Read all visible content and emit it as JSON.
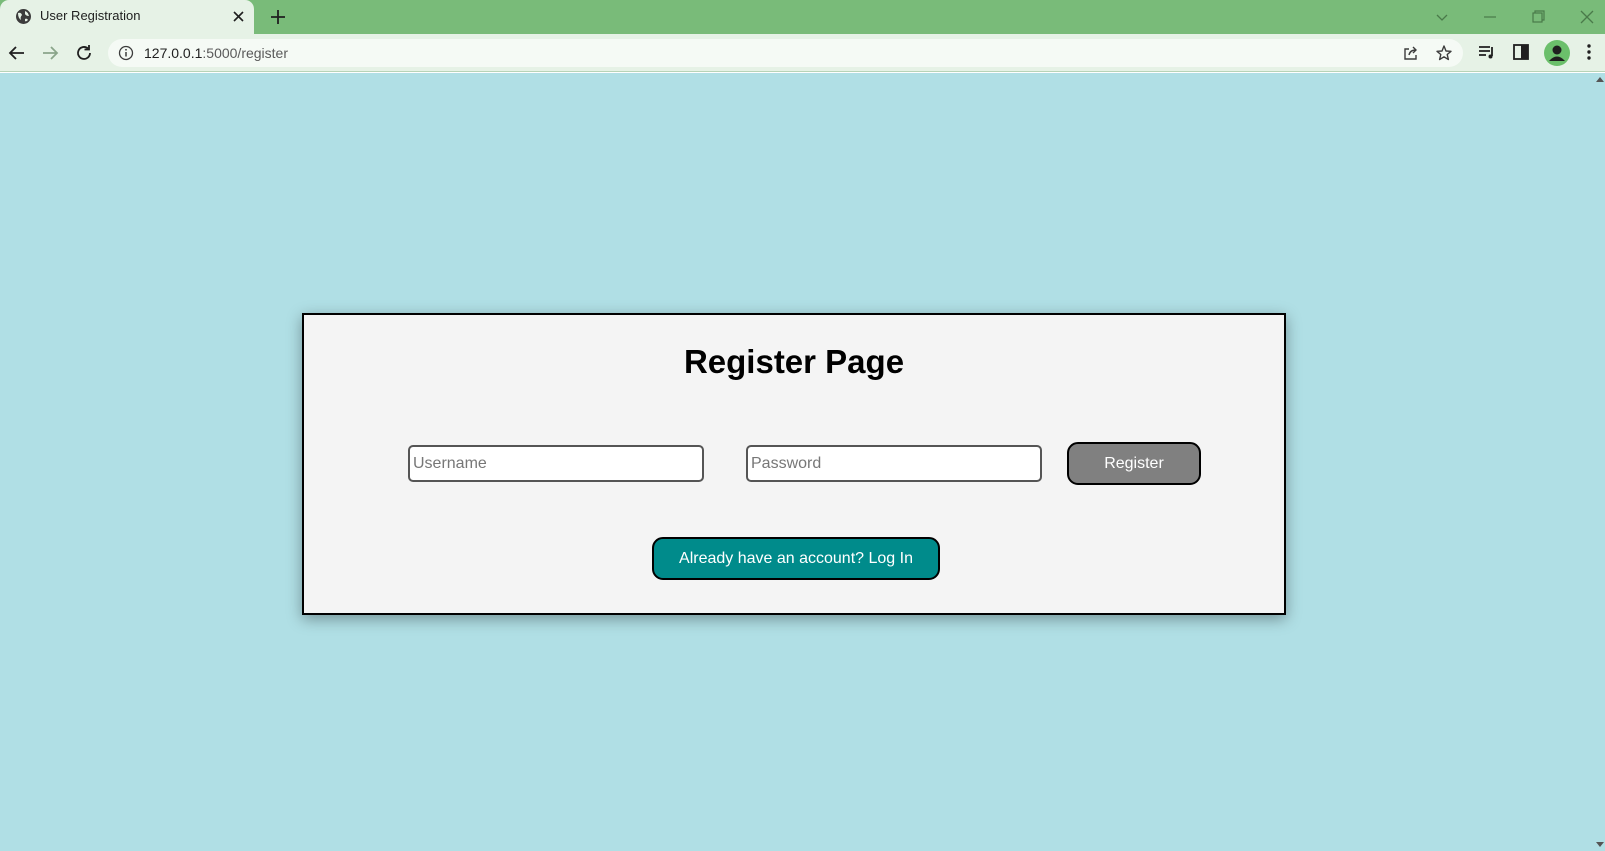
{
  "browser": {
    "tab": {
      "title": "User Registration"
    },
    "url": {
      "host": "127.0.0.1",
      "path": ":5000/register"
    }
  },
  "page": {
    "title": "Register Page",
    "form": {
      "username_placeholder": "Username",
      "username_value": "",
      "password_placeholder": "Password",
      "password_value": "",
      "register_label": "Register"
    },
    "login_link_label": "Already have an account? Log In"
  },
  "colors": {
    "background": "#b0dfe5",
    "card": "#f4f4f4",
    "register_button": "#808080",
    "login_button": "#008b8b",
    "chrome_frame": "#79bb79"
  },
  "icons": {
    "tab_favicon": "globe-icon",
    "tab_close": "close-icon",
    "new_tab": "plus-icon",
    "back": "back-arrow-icon",
    "forward": "forward-arrow-icon",
    "reload": "reload-icon",
    "site_info": "info-icon",
    "share": "share-icon",
    "bookmark": "star-icon",
    "media": "media-queue-icon",
    "side_panel": "side-panel-icon",
    "profile": "profile-avatar-icon",
    "menu": "kebab-menu-icon"
  }
}
